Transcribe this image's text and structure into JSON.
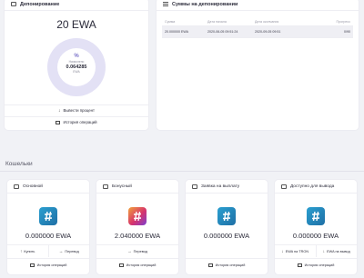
{
  "deposit": {
    "title": "Депонирование",
    "amount": "20 EWA",
    "donut_symbol": "%",
    "donut_label": "Начислено",
    "donut_value": "0.064285",
    "donut_unit": "EWA",
    "withdraw_label": "Вывести процент",
    "history_label": "История операций"
  },
  "sums": {
    "title": "Суммы на депонировании",
    "columns": [
      "Сумма",
      "Дата начала",
      "Дата окончания",
      "Прогресс"
    ],
    "rows": [
      {
        "amount": "20.000000 EWA",
        "start": "2020-06-05 09:51:24",
        "end": "2020-09-05 09:51",
        "progress": "0/90"
      }
    ]
  },
  "wallets_title": "Кошельки",
  "wallets": [
    {
      "title": "Основной",
      "amount": "0.000000 EWA",
      "action1": "Купить",
      "action2": "Перевод",
      "history": "История операций"
    },
    {
      "title": "Бонусный",
      "amount": "2.040000 EWA",
      "action1": "Перевод",
      "history": "История операций"
    },
    {
      "title": "Заявка на выплату",
      "amount": "0.000000 EWA",
      "history": "История операций"
    },
    {
      "title": "Доступно для вывода",
      "amount": "0.000000 EWA",
      "action1": "EWA на TRON",
      "action2": "EWA на вывод",
      "history": "История операций"
    }
  ],
  "icons": {
    "logo": "ewa-logo-icon",
    "withdraw": "arrow-down-icon",
    "history": "history-icon",
    "buy": "arrow-up-icon",
    "transfer": "arrow-right-icon"
  },
  "colors": {
    "logo_blue": "#2a9fd0",
    "donut_ring": "#e3e1f5",
    "accent_purple": "#7a71c9"
  }
}
